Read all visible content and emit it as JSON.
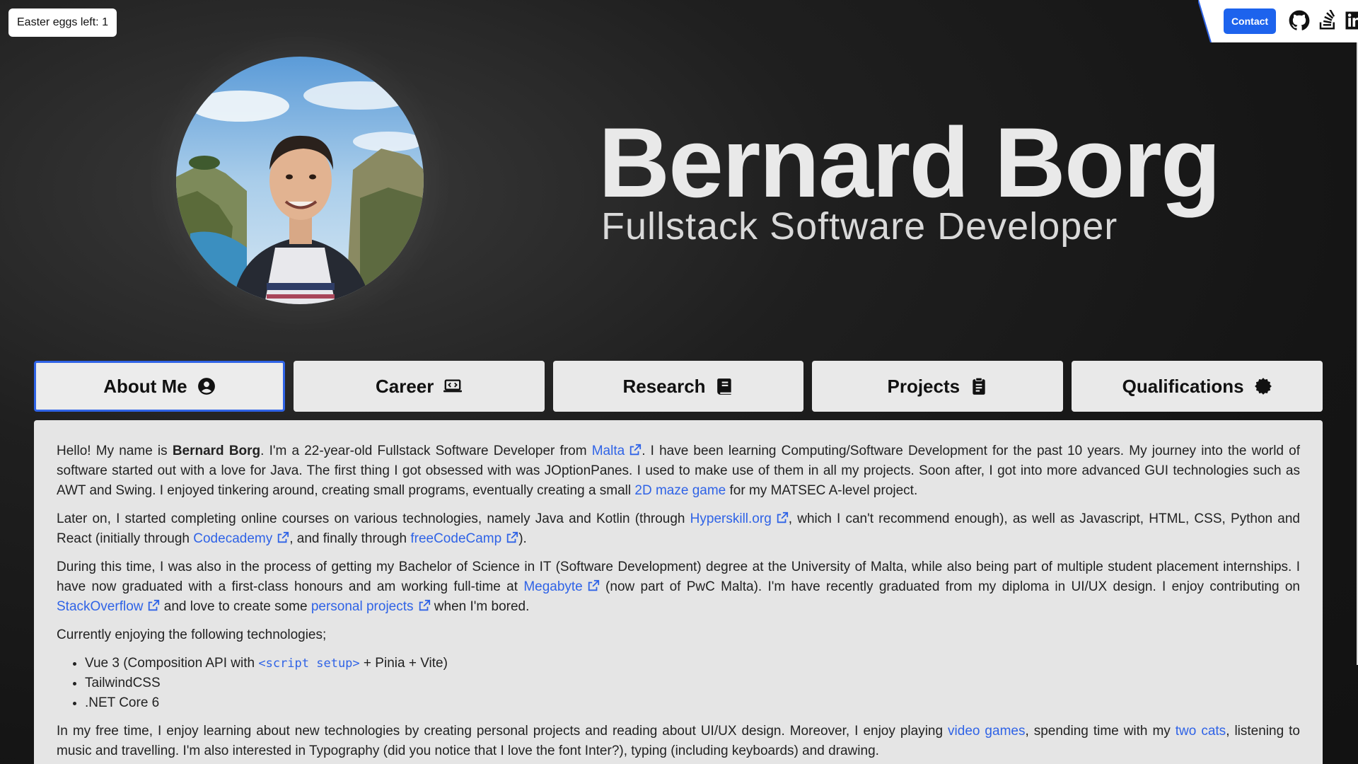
{
  "easter_eggs": {
    "label": "Easter eggs left: 1"
  },
  "top_nav": {
    "contact_label": "Contact",
    "icons": [
      "github-icon",
      "stackoverflow-icon",
      "linkedin-icon"
    ]
  },
  "hero": {
    "name": "Bernard Borg",
    "subtitle": "Fullstack Software Developer"
  },
  "tabs": [
    {
      "label": "About Me",
      "icon": "user-circle-icon",
      "active": true
    },
    {
      "label": "Career",
      "icon": "laptop-code-icon",
      "active": false
    },
    {
      "label": "Research",
      "icon": "book-icon",
      "active": false
    },
    {
      "label": "Projects",
      "icon": "clipboard-list-icon",
      "active": false
    },
    {
      "label": "Qualifications",
      "icon": "certificate-icon",
      "active": false
    }
  ],
  "about": {
    "p1": {
      "t1": "Hello! My name is ",
      "name": "Bernard Borg",
      "t2": ". I'm a 22-year-old Fullstack Software Developer from ",
      "link_malta": "Malta",
      "t3": ". I have been learning Computing/Software Development for the past 10 years. My journey into the world of software started out with a love for Java. The first thing I got obsessed with was JOptionPanes. I used to make use of them in all my projects. Soon after, I got into more advanced GUI technologies such as AWT and Swing. I enjoyed tinkering around, creating small programs, eventually creating a small ",
      "link_maze": "2D maze game",
      "t4": " for my MATSEC A-level project."
    },
    "p2": {
      "t1": "Later on, I started completing online courses on various technologies, namely Java and Kotlin (through ",
      "link_hyperskill": "Hyperskill.org",
      "t2": ", which I can't recommend enough), as well as Javascript, HTML, CSS, Python and React (initially through ",
      "link_codecademy": "Codecademy",
      "t3": ", and finally through ",
      "link_fcc": "freeCodeCamp",
      "t4": ")."
    },
    "p3": {
      "t1": "During this time, I was also in the process of getting my Bachelor of Science in IT (Software Development) degree at the University of Malta, while also being part of multiple student placement internships. I have now graduated with a first-class honours and am working full-time at ",
      "link_megabyte": "Megabyte",
      "t2": " (now part of PwC Malta). I'm have recently graduated from my diploma in UI/UX design. I enjoy contributing on ",
      "link_so": "StackOverflow",
      "t3": " and love to create some ",
      "link_projects": "personal projects",
      "t4": " when I'm bored."
    },
    "p4": "Currently enjoying the following technologies;",
    "tech": {
      "vue_pre": "Vue 3 (Composition API with ",
      "vue_code": "<script setup>",
      "vue_post": " + Pinia + Vite)",
      "tailwind": "TailwindCSS",
      "dotnet": ".NET Core 6"
    },
    "p5": {
      "t1": "In my free time, I enjoy learning about new technologies by creating personal projects and reading about UI/UX design. Moreover, I enjoy playing ",
      "link_games": "video games",
      "t2": ", spending time with my ",
      "link_cats": "two cats",
      "t3": ", listening to music and travelling. I'm also interested in Typography (did you notice that I love the font Inter?), typing (including keyboards) and drawing."
    }
  },
  "colors": {
    "accent": "#2f63e6",
    "contact_bg": "#1d63ed",
    "tab_bg": "#e9e9e9",
    "content_bg": "#e5e5e5"
  }
}
